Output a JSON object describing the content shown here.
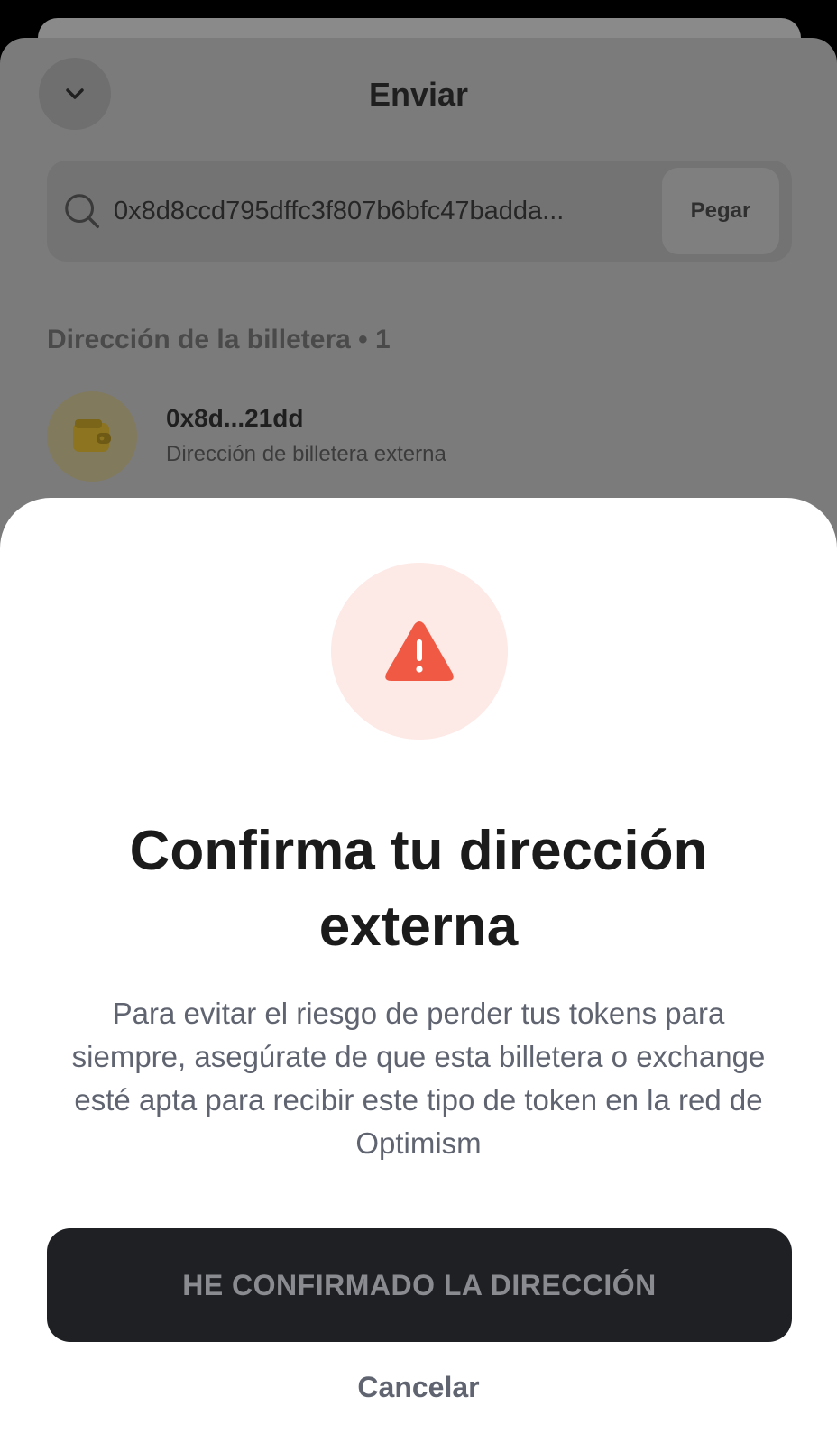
{
  "background_screen": {
    "title": "Enviar",
    "search": {
      "value": "0x8d8ccd795dffc3f807b6bfc47badda...",
      "paste_label": "Pegar"
    },
    "section_label": "Dirección de la billetera • 1",
    "wallet": {
      "address": "0x8d...21dd",
      "subtitle": "Dirección de billetera externa",
      "icon": "wallet-icon"
    }
  },
  "modal": {
    "icon": "warning-icon",
    "title": "Confirma tu dirección externa",
    "body": "Para evitar el riesgo de perder tus tokens para siempre, asegúrate de que esta billetera o exchange esté apta para recibir este tipo de token en la red de Optimism",
    "confirm_label": "HE CONFIRMADO LA DIRECCIÓN",
    "cancel_label": "Cancelar"
  },
  "colors": {
    "warning": "#f05a45",
    "warning_bg": "#fde9e6",
    "button_bg": "#1f2024",
    "overlay": "#7b7b7b"
  }
}
